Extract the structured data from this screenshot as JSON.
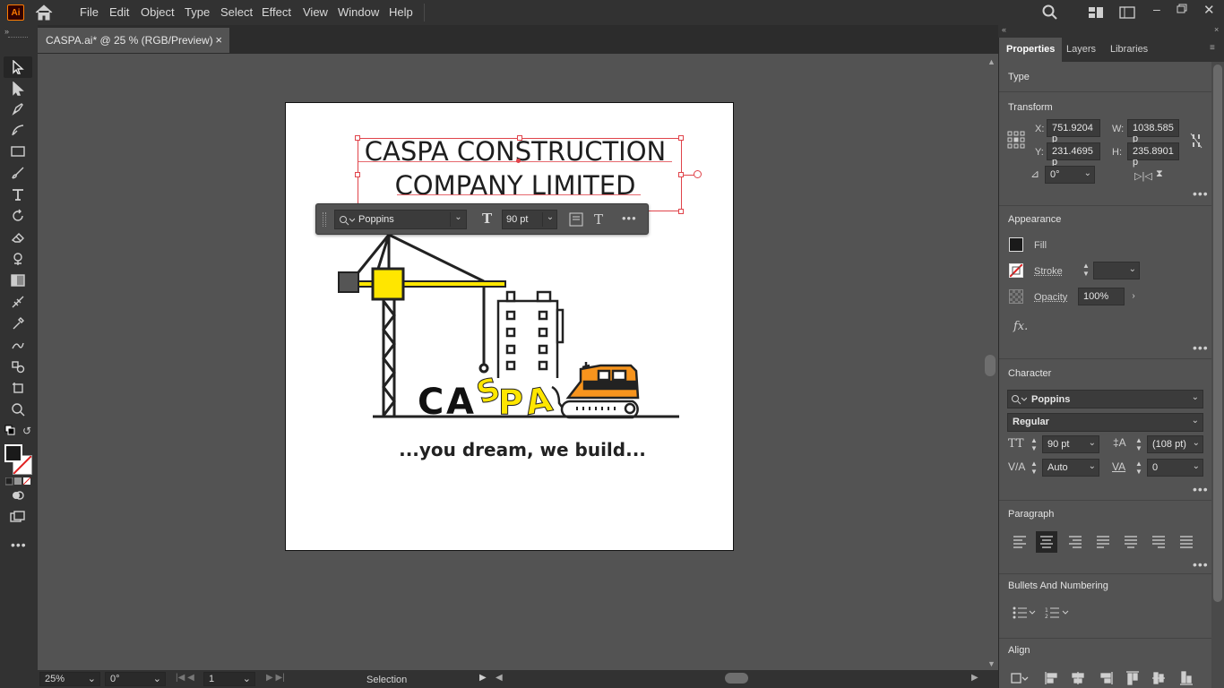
{
  "app": {
    "logo": "Ai"
  },
  "menu": [
    "File",
    "Edit",
    "Object",
    "Type",
    "Select",
    "Effect",
    "View",
    "Window",
    "Help"
  ],
  "document_tab": {
    "title": "CASPA.ai* @ 25 % (RGB/Preview)",
    "close": "×"
  },
  "artwork": {
    "headline_line1": "CASPA CONSTRUCTION",
    "headline_line2": "COMPANY LIMITED",
    "logo_letters": [
      "C",
      "A",
      "S",
      "P",
      "A"
    ],
    "tagline": "...you dream, we build..."
  },
  "context_bar": {
    "font": "Poppins",
    "size": "90 pt"
  },
  "status_bar": {
    "zoom": "25%",
    "rotation": "0°",
    "artboard": "1",
    "tool": "Selection"
  },
  "panel": {
    "tabs": [
      "Properties",
      "Layers",
      "Libraries"
    ],
    "type_title": "Type",
    "transform": {
      "title": "Transform",
      "x_label": "X:",
      "x": "751.9204 p",
      "y_label": "Y:",
      "y": "231.4695 p",
      "w_label": "W:",
      "w": "1038.585 p",
      "h_label": "H:",
      "h": "235.8901 p",
      "angle": "0°"
    },
    "appearance": {
      "title": "Appearance",
      "fill": "Fill",
      "stroke": "Stroke",
      "opacity": "Opacity",
      "opacity_value": "100%",
      "fx": "fx."
    },
    "character": {
      "title": "Character",
      "font": "Poppins",
      "style": "Regular",
      "size": "90 pt",
      "leading": "(108 pt)",
      "kerning": "Auto",
      "tracking": "0"
    },
    "paragraph": {
      "title": "Paragraph"
    },
    "bullets": {
      "title": "Bullets And Numbering"
    },
    "align": {
      "title": "Align"
    }
  },
  "colors": {
    "accent_yellow": "#ffe600",
    "accent_orange": "#f7941d",
    "selection_red": "#e0434a"
  }
}
